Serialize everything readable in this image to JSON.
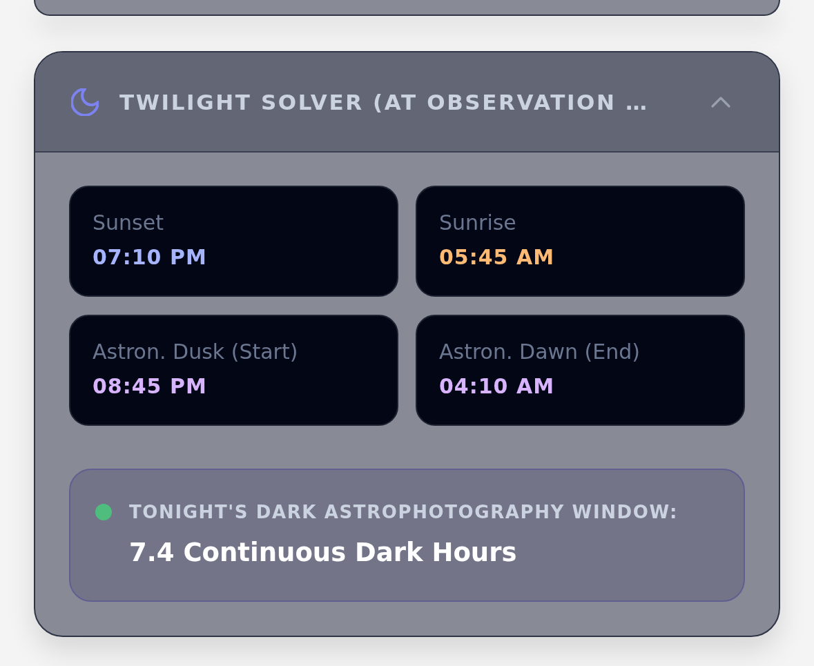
{
  "panel": {
    "title": "TWILIGHT SOLVER (AT OBSERVATION …",
    "expanded": true,
    "times": [
      {
        "label": "Sunset",
        "value": "07:10 PM",
        "color": "#a5b4fc"
      },
      {
        "label": "Sunrise",
        "value": "05:45 AM",
        "color": "#fdba74"
      },
      {
        "label": "Astron. Dusk (Start)",
        "value": "08:45 PM",
        "color": "#d8b4fe"
      },
      {
        "label": "Astron. Dawn (End)",
        "value": "04:10 AM",
        "color": "#d8b4fe"
      }
    ],
    "dark_window": {
      "label": "TONIGHT'S DARK ASTROPHOTOGRAPHY WINDOW:",
      "value": "7.4 Continuous Dark Hours"
    }
  }
}
